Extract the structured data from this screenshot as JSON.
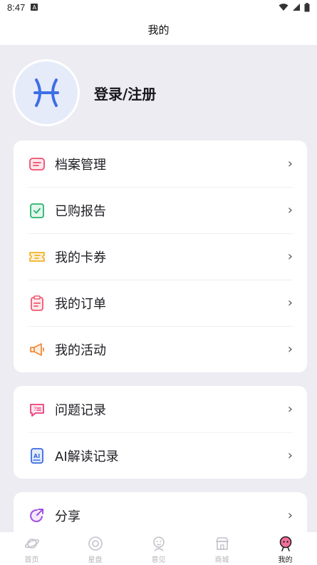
{
  "status_bar": {
    "time": "8:47",
    "badge": "A"
  },
  "header": {
    "title": "我的"
  },
  "profile": {
    "login_label": "登录/注册",
    "avatar_icon": "pisces-icon"
  },
  "menu_group_1": [
    {
      "label": "档案管理",
      "icon": "profile-card-icon",
      "color": "#ef4f6e"
    },
    {
      "label": "已购报告",
      "icon": "check-doc-icon",
      "color": "#29b36f"
    },
    {
      "label": "我的卡券",
      "icon": "ticket-icon",
      "color": "#f3b32a"
    },
    {
      "label": "我的订单",
      "icon": "order-icon",
      "color": "#ef5a6e"
    },
    {
      "label": "我的活动",
      "icon": "megaphone-icon",
      "color": "#f08a3c"
    }
  ],
  "menu_group_2": [
    {
      "label": "问题记录",
      "icon": "question-bubble-icon",
      "color": "#e8417c"
    },
    {
      "label": "AI解读记录",
      "icon": "ai-doc-icon",
      "color": "#3a6be0"
    }
  ],
  "menu_group_3": [
    {
      "label": "分享",
      "icon": "share-icon",
      "color": "#a24fe0"
    }
  ],
  "bottom_nav": [
    {
      "label": "首页",
      "icon": "planet-icon",
      "active": false
    },
    {
      "label": "星盘",
      "icon": "astrolabe-icon",
      "active": false
    },
    {
      "label": "意见",
      "icon": "feedback-face-icon",
      "active": false
    },
    {
      "label": "商城",
      "icon": "shop-icon",
      "active": false
    },
    {
      "label": "我的",
      "icon": "me-icon",
      "active": true
    }
  ]
}
